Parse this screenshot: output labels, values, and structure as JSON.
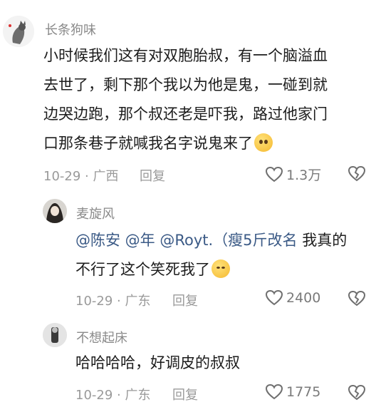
{
  "comments": [
    {
      "username": "长条狗味",
      "text_lines": [
        "小时候我们这有对双胞胎叔，有一个脑溢血",
        "去世了，剩下那个我以为他是鬼，一碰到就",
        "边哭边跑，那个叔还老是吓我，路过他家门",
        "口那条巷子就喊我名字说鬼来了"
      ],
      "emoji": "pleading-face-emoji",
      "date": "10-29",
      "region": "广西",
      "reply_label": "回复",
      "likes": "1.3万"
    },
    {
      "username": "麦旋风",
      "mentions": "@陈安 @年 @Royt.（瘦5斤改名",
      "text_tail": " 我真的",
      "text_line2": "不行了这个笑死我了",
      "emoji": "rolling-laughing-emoji",
      "date": "10-29",
      "region": "广东",
      "reply_label": "回复",
      "likes": "2400"
    },
    {
      "username": "不想起床",
      "text": "哈哈哈哈，好调皮的叔叔",
      "date": "10-29",
      "region": "广东",
      "reply_label": "回复",
      "likes": "1775"
    }
  ],
  "separator": " · "
}
